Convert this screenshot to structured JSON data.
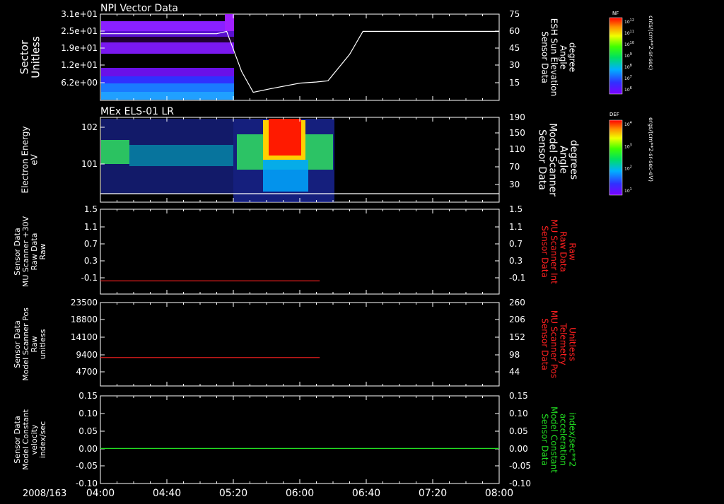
{
  "date_label": "2008/163",
  "x_ticks": [
    "04:00",
    "04:40",
    "05:20",
    "06:00",
    "06:40",
    "07:20",
    "08:00"
  ],
  "colors": {
    "white": "#ffffff",
    "red": "#ff2020",
    "green": "#22dd22",
    "fg": "#ffffff",
    "bg": "#000000"
  },
  "colorbars": [
    {
      "name": "nf",
      "title": "NF",
      "unit": "cnts/(cm**2-sr-sec)",
      "ticks": [
        "10^12",
        "10^11",
        "10^10",
        "10^9",
        "10^8",
        "10^7",
        "10^6"
      ]
    },
    {
      "name": "def",
      "title": "DEF",
      "unit": "ergs/(cm**2-sr-sec-eV)",
      "ticks": [
        "10^4",
        "10^3",
        "10^2",
        "10^1"
      ]
    }
  ],
  "chart_data": [
    {
      "type": "heatmap",
      "title": "NPI Vector Data",
      "ylabel_left": [
        "Sector",
        "Unitless"
      ],
      "left_ticks": [
        "3.1e+01",
        "2.5e+01",
        "1.9e+01",
        "1.2e+01",
        "6.2e+00"
      ],
      "ylabel_right": [
        "Sensor Data",
        "ESH Sun Elevation",
        "Angle",
        "degree"
      ],
      "right_ticks": [
        "75",
        "60",
        "45",
        "30",
        "15"
      ],
      "right_ylim": [
        0,
        75
      ],
      "overlay_line": {
        "color": "white",
        "x": [
          "04:00",
          "04:40",
          "05:10",
          "05:16",
          "05:25",
          "05:32",
          "05:42",
          "06:00",
          "06:10",
          "06:17",
          "06:30",
          "06:38",
          "08:00"
        ],
        "y": [
          58,
          58,
          58,
          60,
          25,
          7,
          10,
          15,
          16,
          17,
          40,
          60,
          60
        ]
      }
    },
    {
      "type": "heatmap",
      "title": "MEx ELS-01 LR",
      "ylabel_left": [
        "Electron Energy",
        "eV"
      ],
      "left_ticks": [
        "10^2",
        "10^1"
      ],
      "ylabel_right": [
        "Sensor Data",
        "Model Scanner",
        "Angle",
        "degrees"
      ],
      "right_ticks": [
        "190",
        "150",
        "110",
        "70",
        "30"
      ],
      "overlay_line": {
        "color": "white",
        "x": [
          "04:00",
          "08:00"
        ],
        "y": [
          10,
          10
        ]
      }
    },
    {
      "type": "line",
      "ylabel_left": [
        "Sensor Data",
        "MU Scanner +30V",
        "Raw Data",
        "Raw"
      ],
      "left_ticks": [
        "1.5",
        "1.1",
        "0.7",
        "0.3",
        "-0.1"
      ],
      "ylim": [
        -0.3,
        1.5
      ],
      "ylabel_right": [
        "Sensor Data",
        "MU Scanner Int",
        "Raw Data",
        "Raw"
      ],
      "right_ticks": [
        "1.5",
        "1.1",
        "0.7",
        "0.3",
        "-0.1"
      ],
      "series": [
        {
          "color": "red",
          "x": [
            "04:00",
            "06:12"
          ],
          "y": [
            -0.02,
            -0.02
          ]
        }
      ]
    },
    {
      "type": "line",
      "ylabel_left": [
        "Sensor Data",
        "Model Scanner Pos",
        "Raw",
        "unitless"
      ],
      "left_ticks": [
        "23500",
        "18800",
        "14100",
        "9400",
        "4700"
      ],
      "ylim": [
        0,
        23500
      ],
      "ylabel_right": [
        "Sensor Data",
        "MU Scanner Pos",
        "Telemetry",
        "Unitless"
      ],
      "right_ticks": [
        "260",
        "206",
        "152",
        "98",
        "44"
      ],
      "series": [
        {
          "color": "red",
          "x": [
            "04:00",
            "06:12"
          ],
          "y": [
            8000,
            8000
          ]
        }
      ]
    },
    {
      "type": "line",
      "ylabel_left": [
        "Sensor Data",
        "Model Constant",
        "velocity",
        "index/sec"
      ],
      "left_ticks": [
        "0.15",
        "0.10",
        "0.05",
        "0.00",
        "-0.05",
        "-0.10"
      ],
      "ylim": [
        -0.1,
        0.15
      ],
      "ylabel_right": [
        "Sensor Data",
        "Model Constant",
        "acceleration",
        "index/sec**2"
      ],
      "right_ticks": [
        "0.15",
        "0.10",
        "0.05",
        "0.00",
        "-0.05",
        "-0.10"
      ],
      "series": [
        {
          "color": "green",
          "x": [
            "04:00",
            "08:00"
          ],
          "y": [
            0,
            0
          ]
        }
      ]
    }
  ]
}
